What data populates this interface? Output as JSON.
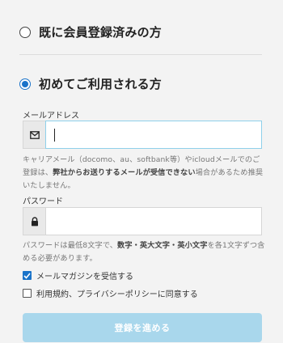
{
  "member_options": {
    "existing_label": "既に会員登録済みの方",
    "new_label": "初めてご利用される方",
    "selected": "new"
  },
  "email": {
    "label": "メールアドレス",
    "value": "",
    "icon": "envelope-icon",
    "hint_prefix": "キャリアメール（docomo、au、softbank等）やicloudメールでのご登録は、",
    "hint_bold": "弊社からお送りするメールが受信できない",
    "hint_suffix": "場合があるため推奨いたしません。"
  },
  "password": {
    "label": "パスワード",
    "value": "",
    "icon": "lock-icon",
    "hint_prefix": "パスワードは最低8文字で、",
    "hint_bold": "数字・英大文字・英小文字",
    "hint_suffix": "を各1文字ずつ含める必要があります。"
  },
  "newsletter": {
    "label": "メールマガジンを受信する",
    "checked": true
  },
  "terms": {
    "label": "利用規約、プライバシーポリシーに同意する",
    "checked": false
  },
  "submit": {
    "label": "登録を進める"
  },
  "colors": {
    "accent": "#1a73c9",
    "button": "#a9d7ec",
    "focus_border": "#8fd0ea"
  }
}
